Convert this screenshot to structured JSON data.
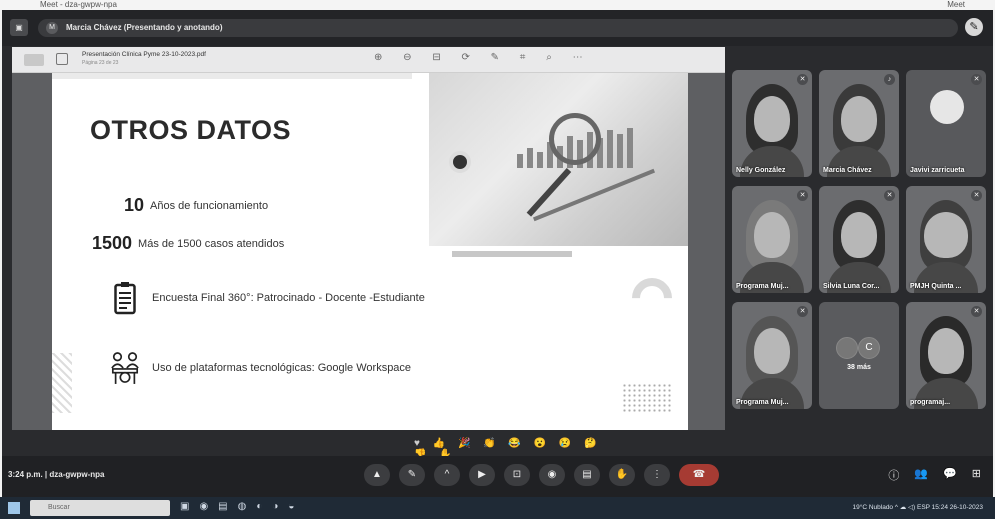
{
  "browser_strip": {
    "left": "Meet - dza-gwpw-npa",
    "right": "Meet"
  },
  "meet": {
    "presenter_title": "Marcia Chávez (Presentando y anotando)",
    "presenter_initial": "M",
    "meeting_code": "3:24 p.m.  |  dza-gwpw-npa"
  },
  "pdf": {
    "filename": "Presentación Clínica Pyme 23-10-2023.pdf",
    "subtitle": "Página 23 de 23",
    "tools": "⊕ ⊖ ⊟ ⟳ ✎ ⌗ ⌕ ⋯"
  },
  "slide": {
    "title": "OTROS DATOS",
    "stat1_num": "10",
    "stat1_text": "Años de funcionamiento",
    "stat2_num": "1500",
    "stat2_text": "Más de 1500 casos atendidos",
    "item1_text": "Encuesta Final 360°: Patrocinado - Docente -Estudiante",
    "item2_text": "Uso de plataformas tecnológicas: Google Workspace"
  },
  "participants": [
    {
      "name": "Nelly González"
    },
    {
      "name": "Marcia Chávez"
    },
    {
      "name": "Javivi zarricueta"
    },
    {
      "name": "Programa Muj..."
    },
    {
      "name": "Silvia Luna Cor..."
    },
    {
      "name": "PMJH Quinta ..."
    },
    {
      "name": "Programa Muj..."
    },
    {
      "name": "38 más"
    },
    {
      "name": "programaj..."
    }
  ],
  "more_bubbles": [
    "",
    "C"
  ],
  "reactions": "♥ 👍 🎉 👏 😂 😮 😢 🤔 👎 ✋",
  "controls": [
    "▲",
    "✎",
    "^",
    "▶",
    "⊡",
    "◉",
    "▤",
    "✋",
    "⋮",
    "☎"
  ],
  "right_controls": [
    "ⓘ",
    "👥",
    "💬",
    "⊞"
  ],
  "taskbar": {
    "search": "Buscar",
    "tray": "19°C Nublado  ^  ☁  ◁)  ESP   15:24  26-10-2023"
  },
  "colors": {
    "meet_bg": "#2a2b2e",
    "end_call": "#a63b33",
    "slide_bg": "#ffffff"
  }
}
